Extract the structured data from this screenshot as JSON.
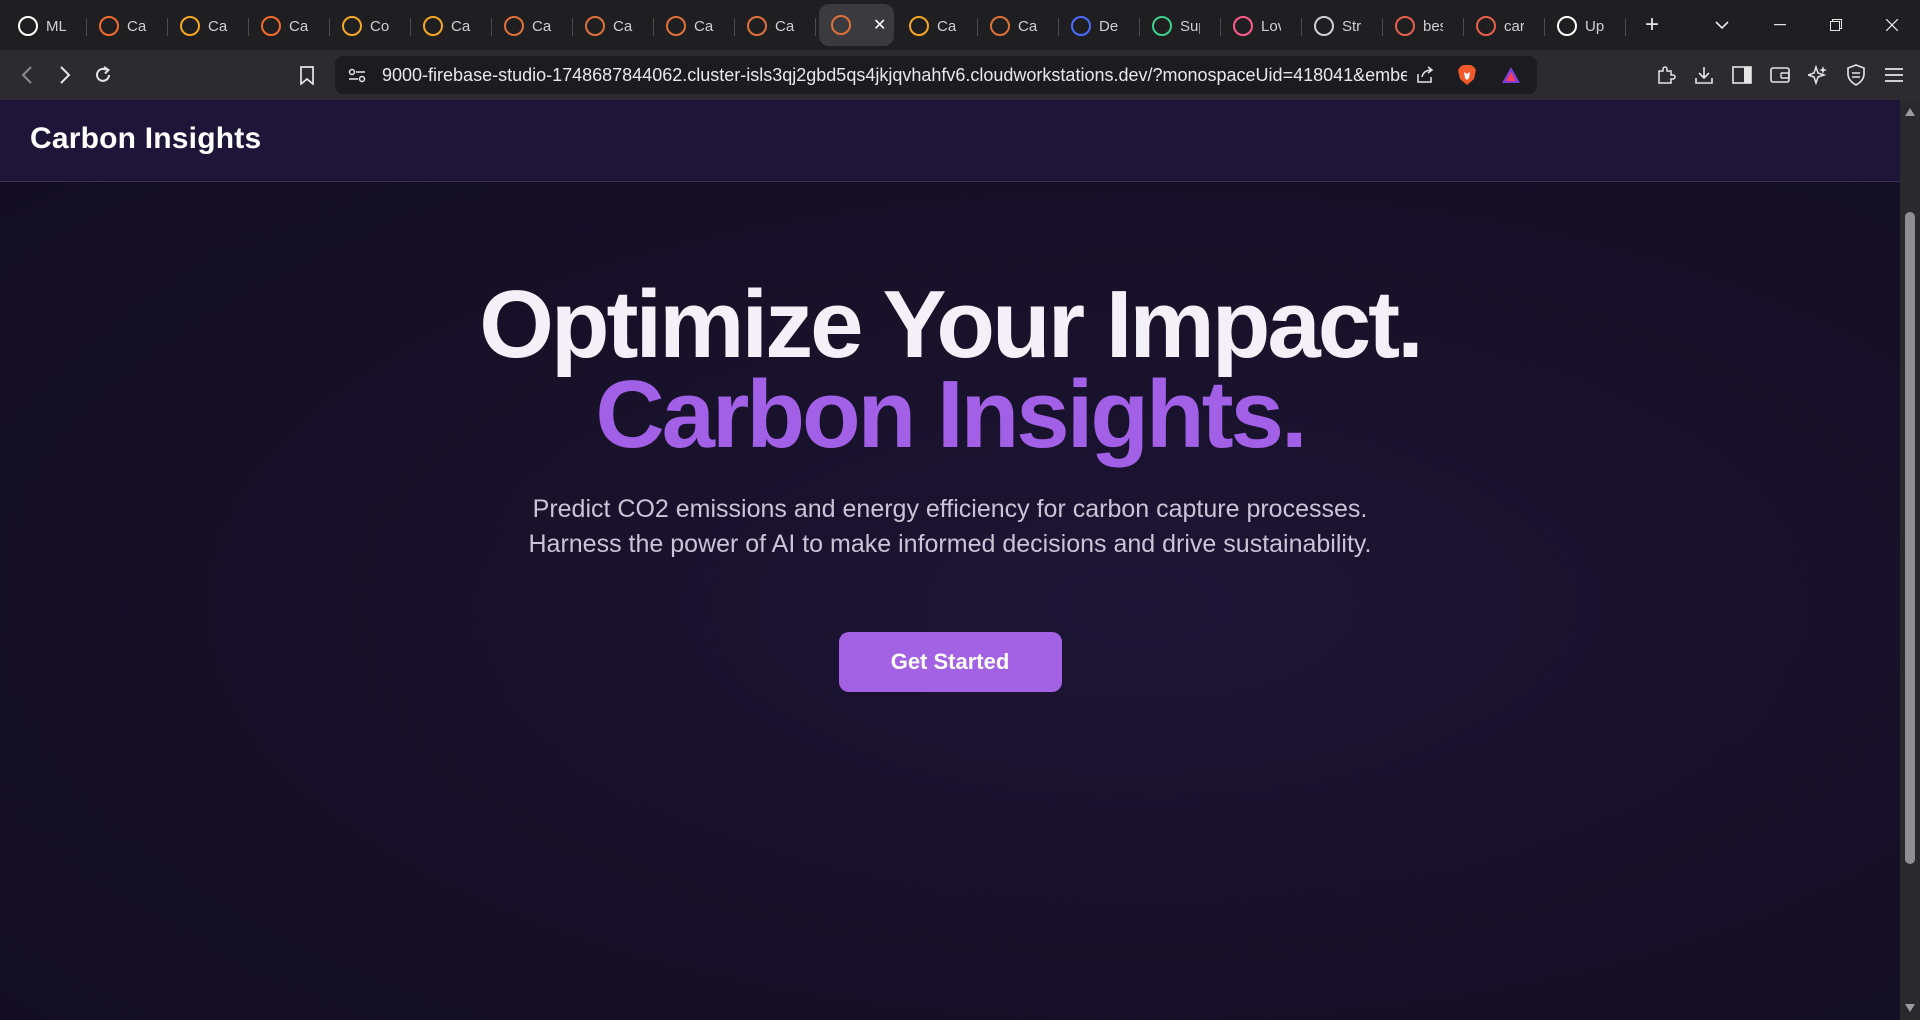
{
  "browser": {
    "tabs": [
      {
        "title": "ML",
        "icon": "openai-icon",
        "color": "#ffffff"
      },
      {
        "title": "Car",
        "icon": "bolt-icon",
        "color": "#f26b2a"
      },
      {
        "title": "Car",
        "icon": "firebase-icon",
        "color": "#f5a623"
      },
      {
        "title": "Car",
        "icon": "bolt-icon",
        "color": "#f26b2a"
      },
      {
        "title": "Co",
        "icon": "firebase-icon",
        "color": "#f5a623"
      },
      {
        "title": "Car",
        "icon": "firebase-icon",
        "color": "#f5a623"
      },
      {
        "title": "Car",
        "icon": "studio-icon",
        "color": "#e0703a"
      },
      {
        "title": "Car",
        "icon": "studio-icon",
        "color": "#e0703a"
      },
      {
        "title": "Car",
        "icon": "studio-icon",
        "color": "#e0703a"
      },
      {
        "title": "Car",
        "icon": "studio-icon",
        "color": "#e0703a"
      },
      {
        "title": "",
        "icon": "studio-icon",
        "color": "#e0703a",
        "active": true
      },
      {
        "title": "Car",
        "icon": "firebase-icon",
        "color": "#f5a623"
      },
      {
        "title": "Car",
        "icon": "studio-icon",
        "color": "#e0703a"
      },
      {
        "title": "De",
        "icon": "deepseek-icon",
        "color": "#4d6bfe"
      },
      {
        "title": "Sup",
        "icon": "supabase-icon",
        "color": "#3ecf8e"
      },
      {
        "title": "Lov",
        "icon": "lovable-icon",
        "color": "#ff5c8a"
      },
      {
        "title": "Str",
        "icon": "globe-icon",
        "color": "#cfcfd4"
      },
      {
        "title": "bes",
        "icon": "brave-icon",
        "color": "#e8604c"
      },
      {
        "title": "car",
        "icon": "brave-icon",
        "color": "#e8604c"
      },
      {
        "title": "Up",
        "icon": "github-icon",
        "color": "#ffffff"
      }
    ],
    "url": "9000-firebase-studio-1748687844062.cluster-isls3qj2gbd5qs4jkjqvhahfv6.cloudworkstations.dev/?monospaceUid=418041&embe..."
  },
  "site": {
    "brand": "Carbon Insights",
    "hero_line1": "Optimize Your Impact.",
    "hero_line2": "Carbon Insights.",
    "description": "Predict CO2 emissions and energy efficiency for carbon capture processes. Harness the power of AI to make informed decisions and drive sustainability.",
    "cta": "Get Started"
  }
}
